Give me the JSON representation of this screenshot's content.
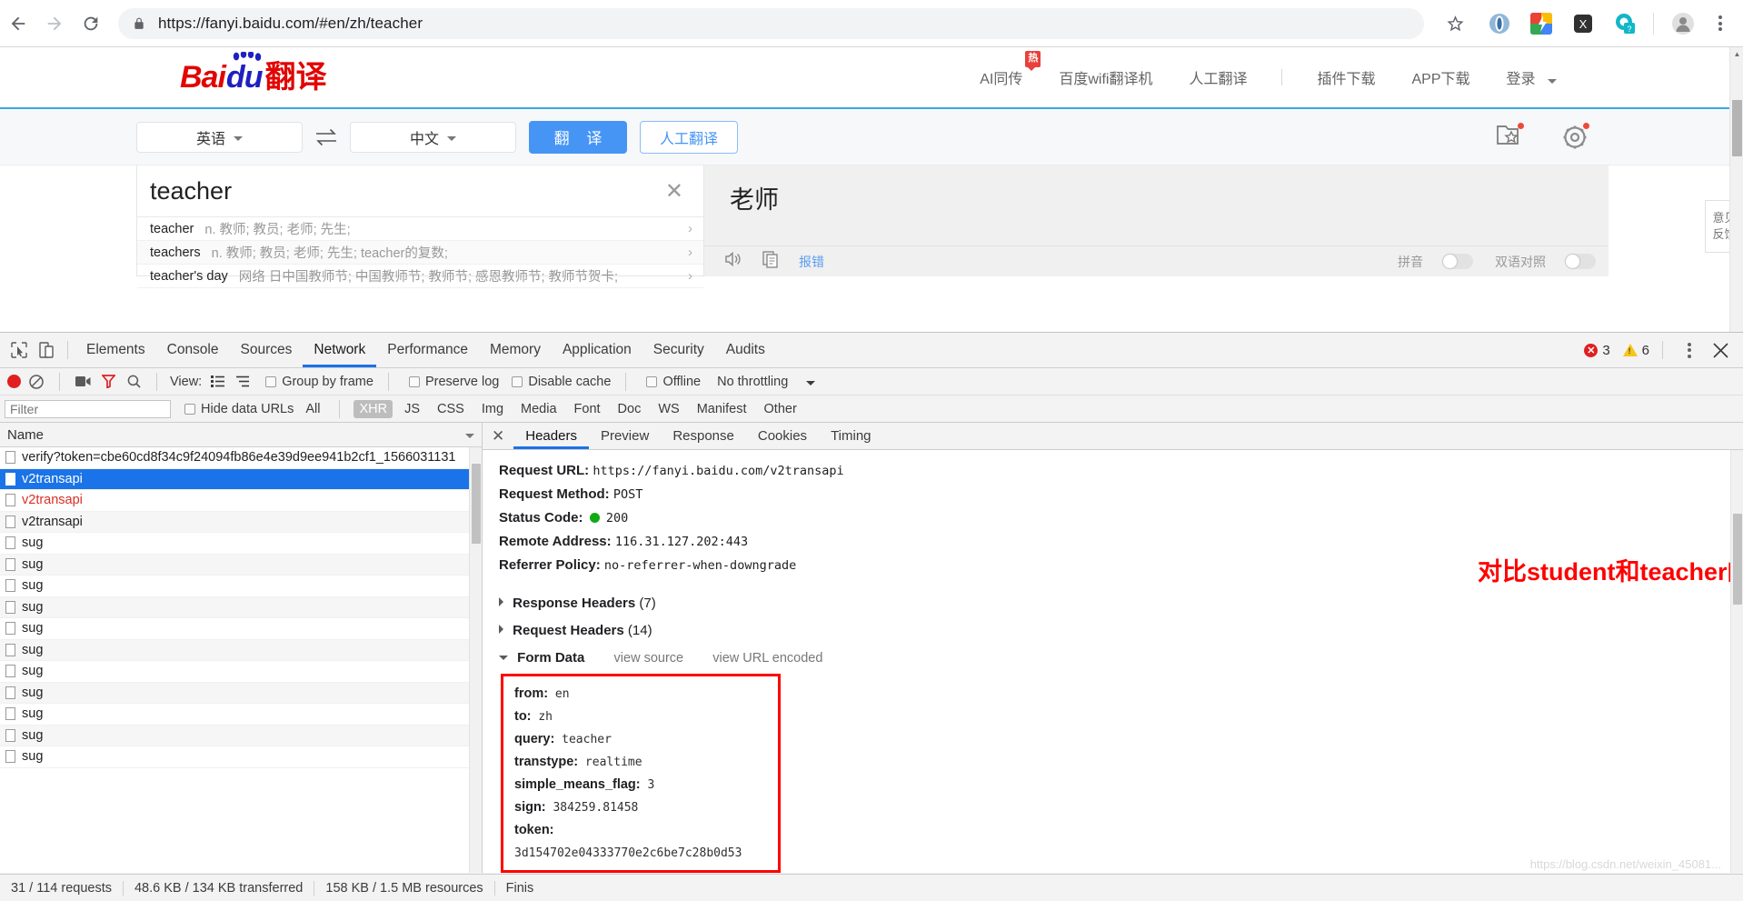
{
  "browser": {
    "url": "https://fanyi.baidu.com/#en/zh/teacher",
    "back_icon": "back-arrow-icon",
    "forward_icon": "forward-arrow-icon",
    "reload_icon": "reload-icon",
    "lock_icon": "lock-icon",
    "star_icon": "star-icon",
    "extensions": [
      "extension-opera-icon",
      "extension-colorful-icon",
      "extension-x-icon",
      "extension-q-help-icon"
    ],
    "profile_icon": "profile-avatar-icon",
    "menu_icon": "three-dot-menu-icon"
  },
  "site": {
    "logo": {
      "bai": "Bai",
      "du": "du",
      "fanyi": "翻译"
    },
    "nav": [
      {
        "label": "AI同传",
        "badge": "热"
      },
      {
        "label": "百度wifi翻译机",
        "badge": ""
      },
      {
        "label": "人工翻译",
        "badge": ""
      },
      {
        "label": "插件下载",
        "badge": ""
      },
      {
        "label": "APP下载",
        "badge": ""
      },
      {
        "label": "登录",
        "badge": ""
      }
    ],
    "feedback_tab": "意见\n反馈"
  },
  "translate": {
    "source_lang": "英语",
    "target_lang": "中文",
    "swap_icon": "swap-arrows-icon",
    "translate_button": "翻 译",
    "human_button": "人工翻译",
    "collection_icon": "collection-folder-star-icon",
    "settings_icon": "settings-gear-icon",
    "input_value": "teacher",
    "clear_icon": "clear-x-icon",
    "suggestions": [
      {
        "word": "teacher",
        "def": "n. 教师; 教员; 老师; 先生;"
      },
      {
        "word": "teachers",
        "def": "n. 教师; 教员; 老师; 先生; teacher的复数;"
      },
      {
        "word": "teacher's day",
        "def": "网络 日中国教师节; 中国教师节; 教师节; 感恩教师节; 教师节贺卡;"
      }
    ],
    "output_value": "老师",
    "speaker_icon": "speaker-icon",
    "copy_icon": "copy-icon",
    "report_link": "报错",
    "pinyin_label": "拼音",
    "bilingual_label": "双语对照"
  },
  "devtools": {
    "tabs": [
      "Elements",
      "Console",
      "Sources",
      "Network",
      "Performance",
      "Memory",
      "Application",
      "Security",
      "Audits"
    ],
    "active_tab": "Network",
    "inspect_icon": "inspect-cursor-icon",
    "device_icon": "device-toggle-icon",
    "error_count": "3",
    "warning_count": "6",
    "more_icon": "three-dot-menu-icon",
    "close_icon": "close-x-icon",
    "network_toolbar": {
      "record_icon": "record-dot-icon",
      "clear_icon": "clear-circle-slash-icon",
      "capture_icon": "camera-icon",
      "filter_icon": "funnel-filter-icon",
      "search_icon": "search-magnifier-icon",
      "view_label": "View:",
      "list_view_icon": "list-view-icon",
      "waterfall_icon": "waterfall-view-icon",
      "group_by_frame": "Group by frame",
      "preserve_log": "Preserve log",
      "disable_cache": "Disable cache",
      "offline": "Offline",
      "throttling": "No throttling",
      "throttling_caret": "chevron-down-icon"
    },
    "filter_bar": {
      "filter_placeholder": "Filter",
      "hide_data_urls": "Hide data URLs",
      "types": [
        "All",
        "XHR",
        "JS",
        "CSS",
        "Img",
        "Media",
        "Font",
        "Doc",
        "WS",
        "Manifest",
        "Other"
      ],
      "active_type": "XHR"
    },
    "list_header": "Name",
    "sort_icon": "chevron-down-icon",
    "requests": [
      {
        "name": "verify?token=cbe60cd8f34c9f24094fb86e4e39d9ee941b2cf1_1566031131",
        "state": "normal"
      },
      {
        "name": "v2transapi",
        "state": "selected"
      },
      {
        "name": "v2transapi",
        "state": "error"
      },
      {
        "name": "v2transapi",
        "state": "normal"
      },
      {
        "name": "sug",
        "state": "normal"
      },
      {
        "name": "sug",
        "state": "normal"
      },
      {
        "name": "sug",
        "state": "normal"
      },
      {
        "name": "sug",
        "state": "normal"
      },
      {
        "name": "sug",
        "state": "normal"
      },
      {
        "name": "sug",
        "state": "normal"
      },
      {
        "name": "sug",
        "state": "normal"
      },
      {
        "name": "sug",
        "state": "normal"
      },
      {
        "name": "sug",
        "state": "normal"
      },
      {
        "name": "sug",
        "state": "normal"
      },
      {
        "name": "sug",
        "state": "normal"
      }
    ],
    "detail": {
      "tabs": [
        "Headers",
        "Preview",
        "Response",
        "Cookies",
        "Timing"
      ],
      "active_tab": "Headers",
      "general": [
        {
          "key": "Request URL:",
          "value": "https://fanyi.baidu.com/v2transapi",
          "status": false
        },
        {
          "key": "Request Method:",
          "value": "POST",
          "status": false
        },
        {
          "key": "Status Code:",
          "value": "200",
          "status": true
        },
        {
          "key": "Remote Address:",
          "value": "116.31.127.202:443",
          "status": false
        },
        {
          "key": "Referrer Policy:",
          "value": "no-referrer-when-downgrade",
          "status": false
        }
      ],
      "response_headers": "Response Headers",
      "response_headers_count": "(7)",
      "request_headers": "Request Headers",
      "request_headers_count": "(14)",
      "form_data_label": "Form Data",
      "view_source": "view source",
      "view_url_encoded": "view URL encoded",
      "form_data": [
        {
          "key": "from:",
          "value": "en"
        },
        {
          "key": "to:",
          "value": "zh"
        },
        {
          "key": "query:",
          "value": "teacher"
        },
        {
          "key": "transtype:",
          "value": "realtime"
        },
        {
          "key": "simple_means_flag:",
          "value": "3"
        },
        {
          "key": "sign:",
          "value": "384259.81458"
        },
        {
          "key": "token:",
          "value": "3d154702e04333770e2c6be7c28b0d53"
        }
      ],
      "annotation": "对比student和teacher的表单不同",
      "annotation_color": "#ff0000"
    },
    "status_bar": {
      "requests": "31 / 114 requests",
      "transferred": "48.6 KB / 134 KB transferred",
      "resources": "158 KB / 1.5 MB resources",
      "finish": "Finis"
    },
    "watermark": "https://blog.csdn.net/weixin_45081..."
  }
}
